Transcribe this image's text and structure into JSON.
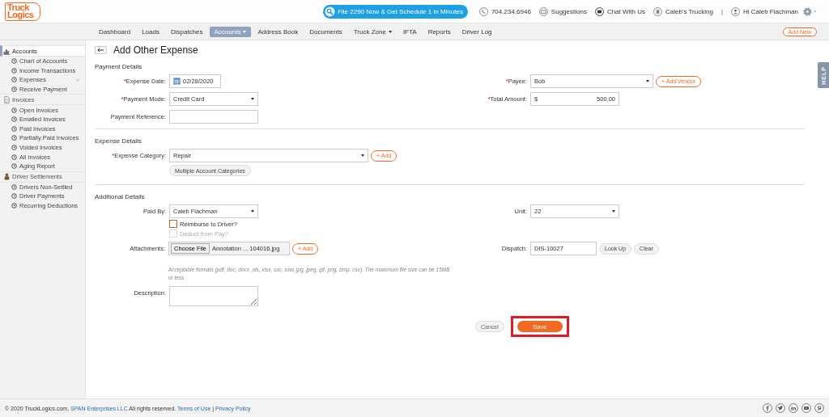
{
  "header": {
    "logo": [
      "Truck",
      "Logics"
    ],
    "promo": "File 2290 Now & Get Schedule 1 in Minutes",
    "links": [
      {
        "kind": "phone",
        "label": "704.234.6946"
      },
      {
        "kind": "mail",
        "label": "Suggestions"
      },
      {
        "kind": "chat",
        "label": "Chat With Us"
      },
      {
        "kind": "company",
        "label": "Caleb's Trucking"
      },
      {
        "kind": "separator",
        "label": "|"
      },
      {
        "kind": "user",
        "label": "Hi Caleb Flachman"
      }
    ]
  },
  "nav": {
    "items": [
      {
        "label": "Dashboard",
        "selected": false,
        "dropdown": false
      },
      {
        "label": "Loads",
        "selected": false,
        "dropdown": false
      },
      {
        "label": "Dispatches",
        "selected": false,
        "dropdown": false
      },
      {
        "label": "Accounts",
        "selected": true,
        "dropdown": true
      },
      {
        "label": "Address Book",
        "selected": false,
        "dropdown": false
      },
      {
        "label": "Documents",
        "selected": false,
        "dropdown": false
      },
      {
        "label": "Truck Zone",
        "selected": false,
        "dropdown": true
      },
      {
        "label": "IFTA",
        "selected": false,
        "dropdown": false
      },
      {
        "label": "Reports",
        "selected": false,
        "dropdown": false
      },
      {
        "label": "Driver Log",
        "selected": false,
        "dropdown": false
      }
    ],
    "add_new": "Add New"
  },
  "sidebar": {
    "sections": [
      {
        "kind": "accounts",
        "title": "Accounts",
        "selected": true,
        "children": [
          {
            "label": "Chart of Accounts",
            "expandable": false
          },
          {
            "label": "Income Transactions",
            "expandable": false
          },
          {
            "label": "Expenses",
            "expandable": true
          },
          {
            "label": "Receive Payment",
            "expandable": false
          }
        ]
      },
      {
        "kind": "invoices",
        "title": "Invoices",
        "selected": false,
        "children": [
          {
            "label": "Open Invoices",
            "expandable": false
          },
          {
            "label": "Emailed Invoices",
            "expandable": false
          },
          {
            "label": "Paid Invoices",
            "expandable": false
          },
          {
            "label": "Partially Paid Invoices",
            "expandable": false
          },
          {
            "label": "Voided Invoices",
            "expandable": false
          },
          {
            "label": "All Invoices",
            "expandable": false
          },
          {
            "label": "Aging Report",
            "expandable": false
          }
        ]
      },
      {
        "kind": "driver",
        "title": "Driver Settlements",
        "selected": false,
        "children": [
          {
            "label": "Drivers Non-Settled",
            "expandable": false
          },
          {
            "label": "Driver Payments",
            "expandable": false
          },
          {
            "label": "Recurring Deductions",
            "expandable": false
          }
        ]
      }
    ]
  },
  "page": {
    "title": "Add Other Expense"
  },
  "sections": [
    {
      "title": "Payment Details",
      "rows": [
        {
          "left": {
            "label": "Expense Date:",
            "required_mark": "*",
            "kind": "date",
            "value": "02/28/2020"
          },
          "right": {
            "label": "Payee:",
            "required_mark": "*",
            "kind": "select",
            "value": "Bob",
            "add_button": "+ Add Vendor"
          }
        },
        {
          "left": {
            "label": "Payment Mode:",
            "required_mark": "*",
            "kind": "select",
            "value": "Credit Card"
          },
          "right": {
            "label": "Total Amount:",
            "required_mark": "*",
            "kind": "amount",
            "currency": "$",
            "value": "500.00"
          }
        },
        {
          "left": {
            "label": "Payment Reference:",
            "kind": "text"
          }
        }
      ]
    },
    {
      "title": "Expense Details",
      "rows": [
        {
          "left": {
            "label": "Expense Category:",
            "required_mark": "*",
            "kind": "select",
            "value": "Repair",
            "add_button": "+ Add",
            "extra_button": "Multiple Account Categories"
          }
        }
      ]
    },
    {
      "title": "Additional Details",
      "rows": [
        {
          "left": {
            "label": "Paid By:",
            "kind": "select",
            "value": "Caleb Flachman",
            "checkboxes": [
              {
                "label": "Reimburse to Driver?",
                "checked": false,
                "disabled": false
              },
              {
                "label": "Deduct from Pay?",
                "checked": false,
                "disabled": true
              }
            ]
          },
          "right": {
            "label": "Unit:",
            "kind": "select",
            "value": "22"
          }
        },
        {
          "left": {
            "label": "Attachments:",
            "kind": "file",
            "button": "Choose File",
            "value": "Annotation ... 104016.jpg",
            "add_button": "+ Add",
            "note": "Acceptable formats (pdf, doc, docx ,xls, xlsx, sxc, sxw, jpg, jpeg, gif, png, bmp, csv). The maximum file size can be 15MB or less"
          },
          "right": {
            "label": "Dispatch:",
            "kind": "lookup",
            "value": "DIS-10027",
            "buttons": [
              "Look Up",
              "Clear"
            ]
          }
        },
        {
          "left": {
            "label": "Description:",
            "kind": "textarea"
          }
        }
      ]
    }
  ],
  "actions": [
    {
      "kind": "cancel",
      "label": "Cancel",
      "highlighted": false
    },
    {
      "kind": "save",
      "label": "Save",
      "highlighted": true
    }
  ],
  "help_tab": "HELP",
  "footer": {
    "text": "© 2020 TruckLogics.com,",
    "company": "SPAN Enterprises LLC",
    "rights": "All rights reserved.",
    "links": [
      "Terms of Use",
      "Privacy Policy"
    ],
    "link_separator": "|",
    "social": [
      {
        "kind": "facebook"
      },
      {
        "kind": "twitter"
      },
      {
        "kind": "linkedin"
      },
      {
        "kind": "youtube"
      },
      {
        "kind": "pinterest"
      }
    ]
  }
}
